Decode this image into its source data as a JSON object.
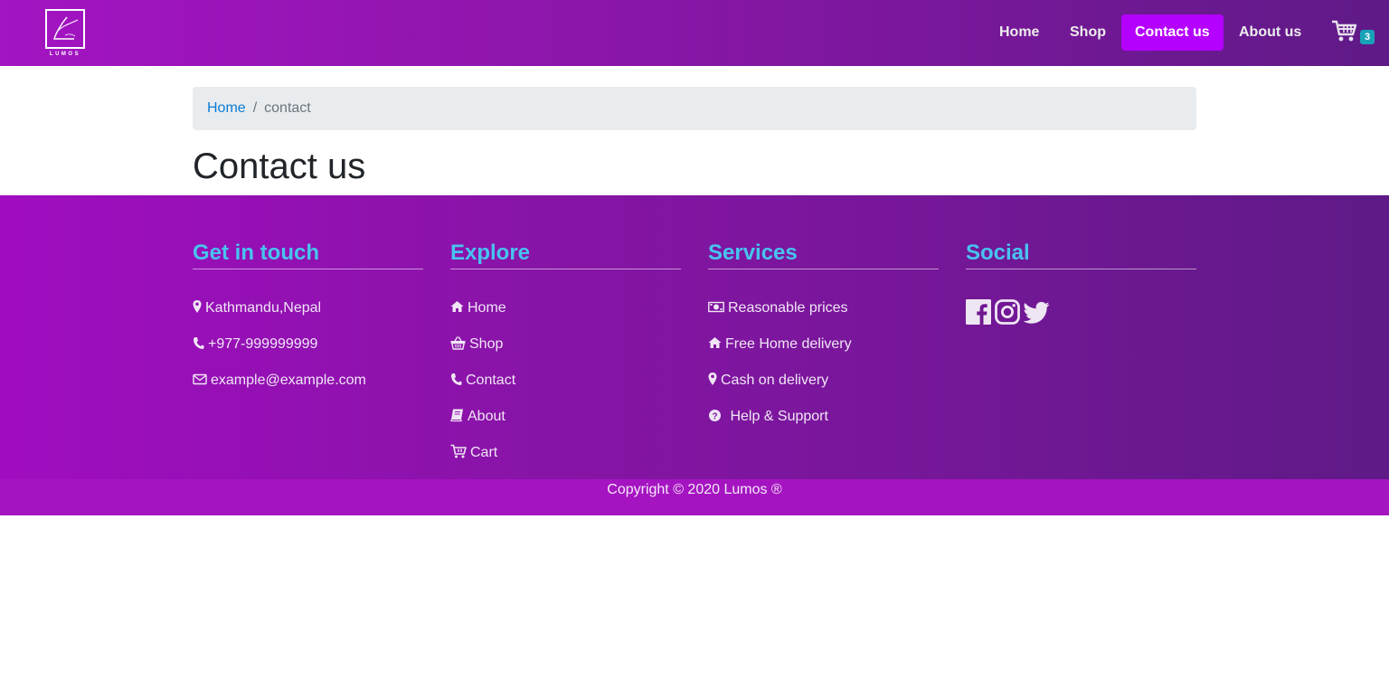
{
  "brand": {
    "name": "LUMOS"
  },
  "nav": {
    "items": [
      {
        "label": "Home",
        "active": false
      },
      {
        "label": "Shop",
        "active": false
      },
      {
        "label": "Contact us",
        "active": true
      },
      {
        "label": "About us",
        "active": false
      }
    ],
    "cart_count": "3"
  },
  "breadcrumb": {
    "home": "Home",
    "separator": "/",
    "current": "contact"
  },
  "page_title": "Contact us",
  "footer": {
    "get_in_touch": {
      "title": "Get in touch",
      "items": [
        {
          "icon": "map-marker-icon",
          "label": "Kathmandu,Nepal"
        },
        {
          "icon": "phone-icon",
          "label": "+977-999999999"
        },
        {
          "icon": "envelope-icon",
          "label": "example@example.com"
        }
      ]
    },
    "explore": {
      "title": "Explore",
      "items": [
        {
          "icon": "home-icon",
          "label": "Home"
        },
        {
          "icon": "basket-icon",
          "label": "Shop"
        },
        {
          "icon": "phone-icon",
          "label": "Contact"
        },
        {
          "icon": "book-icon",
          "label": "About"
        },
        {
          "icon": "cart-icon",
          "label": "Cart"
        }
      ]
    },
    "services": {
      "title": "Services",
      "items": [
        {
          "icon": "money-icon",
          "label": "Reasonable prices"
        },
        {
          "icon": "home-icon",
          "label": "Free Home delivery"
        },
        {
          "icon": "map-marker-icon",
          "label": "Cash on delivery"
        },
        {
          "icon": "question-circle-icon",
          "label": " Help & Support"
        }
      ]
    },
    "social": {
      "title": "Social",
      "icons": [
        "facebook-icon",
        "instagram-icon",
        "twitter-icon"
      ]
    },
    "copyright": "Copyright © 2020 Lumos ®"
  },
  "colors": {
    "nav_active": "#b400ff",
    "heading": "#48c3ee",
    "badge": "#17a2b8",
    "link": "#0a7bd6"
  }
}
